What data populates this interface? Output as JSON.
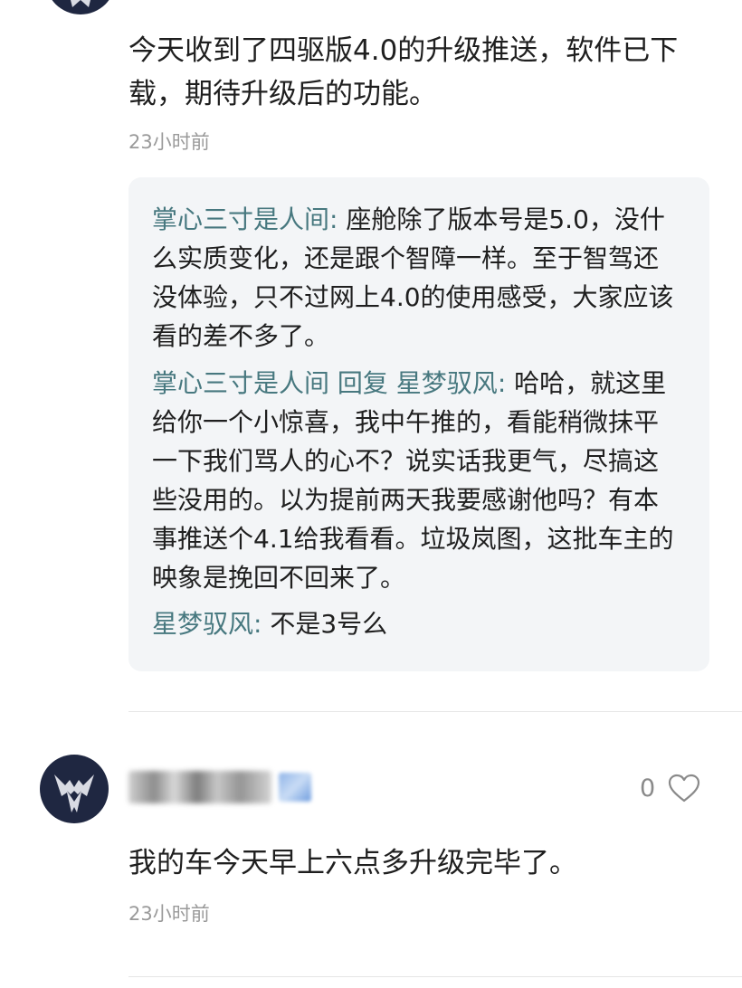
{
  "comments": [
    {
      "text": "今天收到了四驱版4.0的升级推送，软件已下载，期待升级后的功能。",
      "time": "23小时前",
      "replies": [
        {
          "name": "掌心三寸是人间",
          "sep": ": ",
          "text": "座舱除了版本号是5.0，没什么实质变化，还是跟个智障一样。至于智驾还没体验，只不过网上4.0的使用感受，大家应该看的差不多了。"
        },
        {
          "name": "掌心三寸是人间 回复 星梦驭风",
          "sep": ": ",
          "text": "哈哈，就这里给你一个小惊喜，我中午推的，看能稍微抹平一下我们骂人的心不？说实话我更气，尽搞这些没用的。以为提前两天我要感谢他吗？有本事推送个4.1给我看看。垃圾岚图，这批车主的映象是挽回不回来了。"
        },
        {
          "name": "星梦驭风",
          "sep": ": ",
          "text": "不是3号么"
        }
      ]
    },
    {
      "text": "我的车今天早上六点多升级完毕了。",
      "time": "23小时前",
      "likes": "0"
    }
  ],
  "icons": {
    "like": "heart-outline-icon",
    "avatar": "brand-logo-avatar"
  },
  "colors": {
    "reply_name": "#47787f",
    "avatar_bg": "#1f2741"
  }
}
